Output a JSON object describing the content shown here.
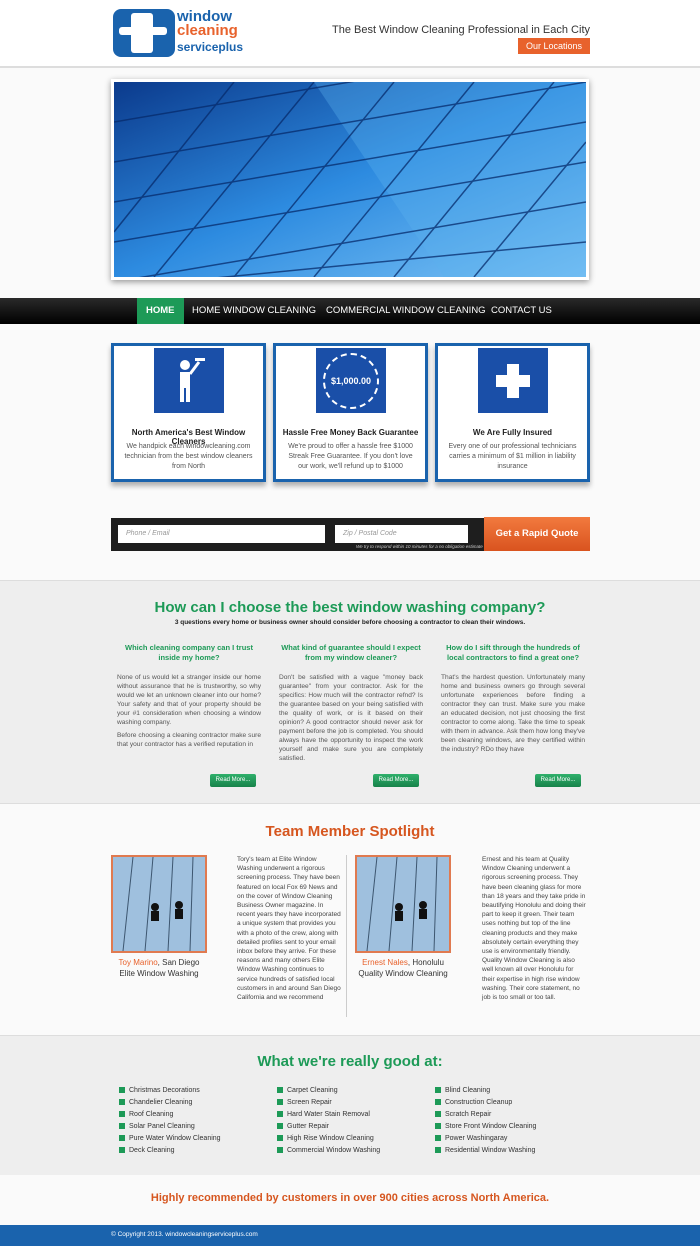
{
  "brand": {
    "logo_line1": "window",
    "logo_line2": "cleaning",
    "logo_line3": "serviceplus"
  },
  "header": {
    "tagline": "The Best Window Cleaning Professional in Each City",
    "locations_button": "Our Locations"
  },
  "nav": {
    "items": [
      "HOME",
      "HOME WINDOW CLEANING",
      "COMMERCIAL WINDOW CLEANING",
      "CONTACT US"
    ]
  },
  "features": [
    {
      "icon": "window-cleaner-icon",
      "title": "North America's Best Window Cleaners",
      "text": "We handpick each windowcleaning.com technician from the best window cleaners from North"
    },
    {
      "icon": "guarantee-seal-icon",
      "badge": "$1,000.00",
      "title": "Hassle Free Money Back Guarantee",
      "text": "We're proud to offer a hassle free $1000 Streak Free Guarantee. If you don't love our work, we'll refund up to $1000"
    },
    {
      "icon": "medical-cross-icon",
      "title": "We Are Fully Insured",
      "text": "Every one of our professional technicians carries a minimum of $1 million in liability insurance"
    }
  ],
  "quote_form": {
    "phone_placeholder": "Phone / Email",
    "zip_placeholder": "Zip / Postal Code",
    "button": "Get a Rapid Quote",
    "note": "We try to respond within 10 minutes for a no obligation estimate"
  },
  "faq": {
    "title": "How can I choose the best window washing company?",
    "subtitle": "3 questions every home or business owner should consider before choosing a contractor to clean their windows.",
    "columns": [
      {
        "q": "Which cleaning company can I trust inside my home?",
        "a1": "None of us would let a stranger inside our home without assurance that he is trustworthy, so why would we let an unknown cleaner into our home? Your safety and that of your property should be your #1 consideration when choosing a window washing company.",
        "a2": "Before choosing a cleaning contractor make sure that your contractor has a verified reputation in",
        "more": "Read More..."
      },
      {
        "q": "What kind of guarantee should I expect from my window cleaner?",
        "a1": "Don't be satisfied with a vague \"money back guarantee\" from your contractor. Ask for the specifics: How much will the contractor refnd? Is the guarantee based on your being satisfied with the quality of work, or is it based on their opinion? A good contractor should never ask for payment before the job is completed. You should always have the opportunity to inspect the work yourself and make sure you are completely satisfied.",
        "a2": "",
        "more": "Read More..."
      },
      {
        "q": "How do I sift through the hundreds of local contractors to find a great one?",
        "a1": "That's the hardest question. Unfortunately many home and business owners go through several unfortunate experiences before finding a contractor they can trust. Make sure you make an educated decision, not just choosing the first contractor to come along. Take the time to speak with them in advance. Ask them how long they've been cleaning windows, are they certified within the industry? RDo they have",
        "a2": "",
        "more": "Read More..."
      }
    ]
  },
  "team": {
    "title": "Team Member Spotlight",
    "members": [
      {
        "name": "Toy Marino",
        "city": ", San Diego",
        "company": "Elite Window Washing",
        "bio": "Tory's team at Elite Window Washing underwent a rigorous screening process. They have been featured on local Fox 69 News and on the cover of Window Cleaning Business Owner magazine. In recent years they have incorporated a unique system that provides you with a photo of the crew, along with detailed profiles sent to your email inbox before they arrive. For these reasons and many others Elite Window Washing continues to service hundreds of satisfied local customers in and around San Diego California and we recommend"
      },
      {
        "name": "Ernest Nales",
        "city": ", Honolulu",
        "company": "Quality Window Cleaning",
        "bio": "Ernest and his team at Quality Window Cleaning underwent a rigorous screening process. They have been cleaning glass for more than 18 years and they take pride in beautifying Honolulu and doing their part to keep it green. Their team uses nothing but top of the line cleaning products and they make absolutely certain everything they use is environmentally friendly. Quality Window Cleaning is also well known all over Honolulu for their expertise in high rise window washing. Their core statement, no job is too small or too tall."
      }
    ]
  },
  "services": {
    "title": "What we're really good at:",
    "columns": [
      [
        "Christmas Decorations",
        "Chandelier Cleaning",
        "Roof Cleaning",
        "Solar Panel Cleaning",
        "Pure Water Window Cleaning",
        "Deck Cleaning"
      ],
      [
        "Carpet Cleaning",
        "Screen Repair",
        "Hard Water Stain Removal",
        "Gutter Repair",
        "High Rise Window Cleaning",
        "Commercial Window Washing"
      ],
      [
        "Blind Cleaning",
        "Construction Cleanup",
        "Scratch Repair",
        "Store Front Window Cleaning",
        "Power Washingaray",
        "Residential Window Washing"
      ]
    ]
  },
  "recommend": "Highly recommended by customers in over 900 cities across North America.",
  "footer": {
    "copyright": "© Copyright 2013. windowcleaningserviceplus.com"
  },
  "colors": {
    "blue": "#1a63ad",
    "green": "#1d9a57",
    "orange": "#e8622c"
  }
}
